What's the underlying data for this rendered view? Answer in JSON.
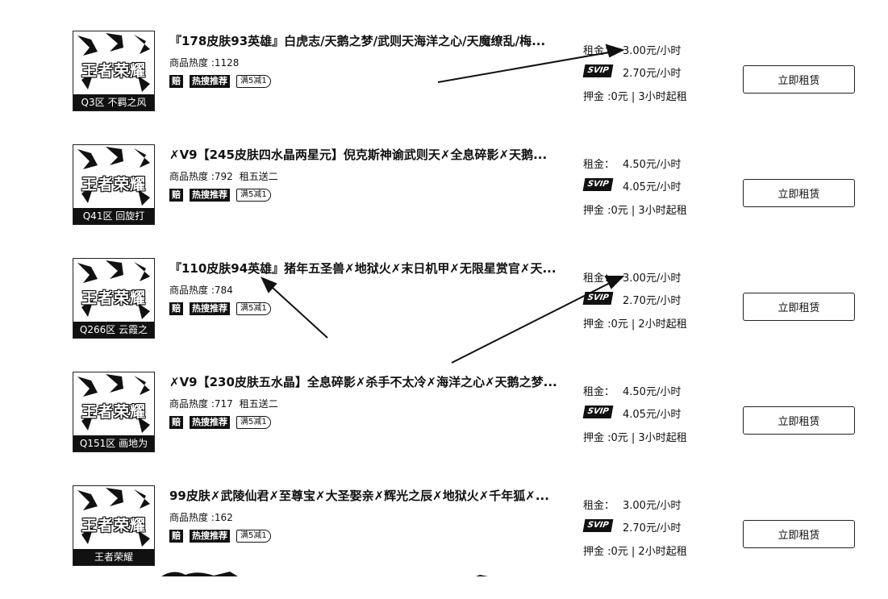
{
  "listings": [
    {
      "title": "『178皮肤93英雄』白虎志/天鹅之梦/武则天海洋之心/天魔缭乱/梅...",
      "heat_label": "商品热度 :",
      "heat_value": "1128",
      "promo": "",
      "thumb_server": "Q3区 不羁之风",
      "rent_label": "租金：",
      "rent_price": "3.00元/小时",
      "svip_label": "SVIP",
      "svip_price": "2.70元/小时",
      "deposit": "押金 :0元 | 3小时起租",
      "button": "立即租赁"
    },
    {
      "title": "✗V9【245皮肤四水晶两星元】倪克斯神谕武则天✗全息碎影✗天鹅...",
      "heat_label": "商品热度 :",
      "heat_value": "792",
      "promo": "租五送二",
      "thumb_server": "Q41区 回旋打",
      "rent_label": "租金：",
      "rent_price": "4.50元/小时",
      "svip_label": "SVIP",
      "svip_price": "4.05元/小时",
      "deposit": "押金 :0元 | 3小时起租",
      "button": "立即租赁"
    },
    {
      "title": "『110皮肤94英雄』猪年五圣兽✗地狱火✗末日机甲✗无限星赏官✗天...",
      "heat_label": "商品热度 :",
      "heat_value": "784",
      "promo": "",
      "thumb_server": "Q266区 云霞之",
      "rent_label": "租金：",
      "rent_price": "3.00元/小时",
      "svip_label": "SVIP",
      "svip_price": "2.70元/小时",
      "deposit": "押金 :0元 | 2小时起租",
      "button": "立即租赁"
    },
    {
      "title": "✗V9【230皮肤五水晶】全息碎影✗杀手不太冷✗海洋之心✗天鹅之梦...",
      "heat_label": "商品热度 :",
      "heat_value": "717",
      "promo": "租五送二",
      "thumb_server": "Q151区 画地为",
      "rent_label": "租金：",
      "rent_price": "4.50元/小时",
      "svip_label": "SVIP",
      "svip_price": "4.05元/小时",
      "deposit": "押金 :0元 | 3小时起租",
      "button": "立即租赁"
    },
    {
      "title": "99皮肤✗武陵仙君✗至尊宝✗大圣娶亲✗辉光之辰✗地狱火✗千年狐✗...",
      "heat_label": "商品热度 :",
      "heat_value": "162",
      "promo": "",
      "thumb_server": "王者荣耀",
      "rent_label": "租金：",
      "rent_price": "3.00元/小时",
      "svip_label": "SVIP",
      "svip_price": "2.70元/小时",
      "deposit": "押金 :0元 | 2小时起租",
      "button": "立即租赁"
    }
  ],
  "tags": {
    "compensate": "赔",
    "hot": "热搜推荐",
    "discount": "满5减1"
  },
  "thumb_logo": "王者荣耀",
  "colors": {
    "ink": "#111111",
    "paper": "#ffffff"
  }
}
